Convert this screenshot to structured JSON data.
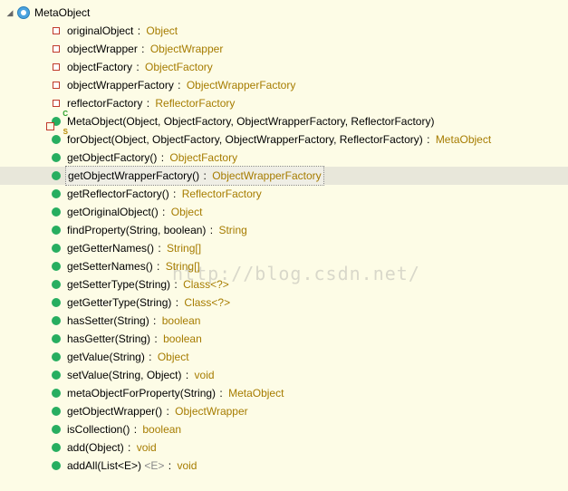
{
  "class": {
    "name": "MetaObject"
  },
  "members": [
    {
      "kind": "field",
      "name": "originalObject",
      "type": "Object"
    },
    {
      "kind": "field",
      "name": "objectWrapper",
      "type": "ObjectWrapper"
    },
    {
      "kind": "field",
      "name": "objectFactory",
      "type": "ObjectFactory"
    },
    {
      "kind": "field",
      "name": "objectWrapperFactory",
      "type": "ObjectWrapperFactory"
    },
    {
      "kind": "field",
      "name": "reflectorFactory",
      "type": "ReflectorFactory"
    },
    {
      "kind": "constructor",
      "badge": "C",
      "name": "MetaObject(Object, ObjectFactory, ObjectWrapperFactory, ReflectorFactory)",
      "type": null
    },
    {
      "kind": "method",
      "badge": "S",
      "name": "forObject(Object, ObjectFactory, ObjectWrapperFactory, ReflectorFactory)",
      "type": "MetaObject"
    },
    {
      "kind": "method",
      "name": "getObjectFactory()",
      "type": "ObjectFactory"
    },
    {
      "kind": "method",
      "name": "getObjectWrapperFactory()",
      "type": "ObjectWrapperFactory",
      "selected": true
    },
    {
      "kind": "method",
      "name": "getReflectorFactory()",
      "type": "ReflectorFactory"
    },
    {
      "kind": "method",
      "name": "getOriginalObject()",
      "type": "Object"
    },
    {
      "kind": "method",
      "name": "findProperty(String, boolean)",
      "type": "String"
    },
    {
      "kind": "method",
      "name": "getGetterNames()",
      "type": "String[]"
    },
    {
      "kind": "method",
      "name": "getSetterNames()",
      "type": "String[]"
    },
    {
      "kind": "method",
      "name": "getSetterType(String)",
      "type": "Class<?>"
    },
    {
      "kind": "method",
      "name": "getGetterType(String)",
      "type": "Class<?>"
    },
    {
      "kind": "method",
      "name": "hasSetter(String)",
      "type": "boolean"
    },
    {
      "kind": "method",
      "name": "hasGetter(String)",
      "type": "boolean"
    },
    {
      "kind": "method",
      "name": "getValue(String)",
      "type": "Object"
    },
    {
      "kind": "method",
      "name": "setValue(String, Object)",
      "type": "void"
    },
    {
      "kind": "method",
      "name": "metaObjectForProperty(String)",
      "type": "MetaObject"
    },
    {
      "kind": "method",
      "name": "getObjectWrapper()",
      "type": "ObjectWrapper"
    },
    {
      "kind": "method",
      "name": "isCollection()",
      "type": "boolean"
    },
    {
      "kind": "method",
      "name": "add(Object)",
      "type": "void"
    },
    {
      "kind": "method",
      "name": "addAll(List<E>)",
      "generic": "<E>",
      "type": "void"
    }
  ],
  "watermark": "http://blog.csdn.net/"
}
